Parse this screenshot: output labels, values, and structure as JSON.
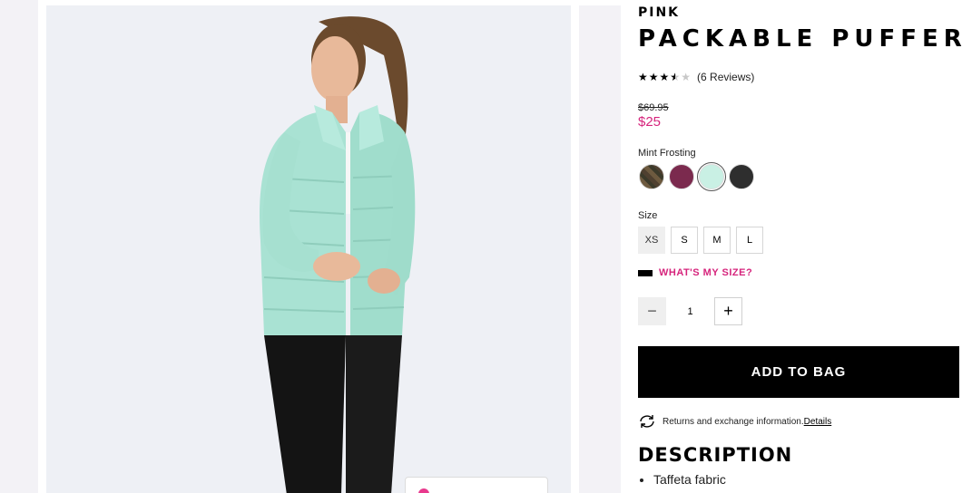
{
  "gallery": {
    "main_image_alt": "model wearing mint packable puffer jacket and black leggings"
  },
  "product": {
    "brand": "PINK",
    "title": "PACKABLE PUFFER",
    "rating_stars": "★★★★★",
    "rating_value": 3.5,
    "reviews": "(6 Reviews)",
    "old_price": "$69.95",
    "price": "$25",
    "color_selected": "Mint Frosting",
    "swatches": [
      {
        "name": "camo",
        "color": "#5a4a32"
      },
      {
        "name": "berry",
        "color": "#7b2a4e"
      },
      {
        "name": "mint",
        "color": "#c9f0e4"
      },
      {
        "name": "black",
        "color": "#2e2e2e"
      }
    ],
    "size_label": "Size",
    "sizes": [
      "XS",
      "S",
      "M",
      "L"
    ],
    "size_guide": "WHAT'S MY SIZE?",
    "quantity": "1",
    "add_to_bag": "ADD TO BAG",
    "returns_text": "Returns and exchange information.",
    "returns_link": "Details",
    "description_heading": "DESCRIPTION",
    "description_items": [
      "Taffeta fabric"
    ]
  },
  "colors": {
    "accent_pink": "#d6247c",
    "button_black": "#000000"
  }
}
